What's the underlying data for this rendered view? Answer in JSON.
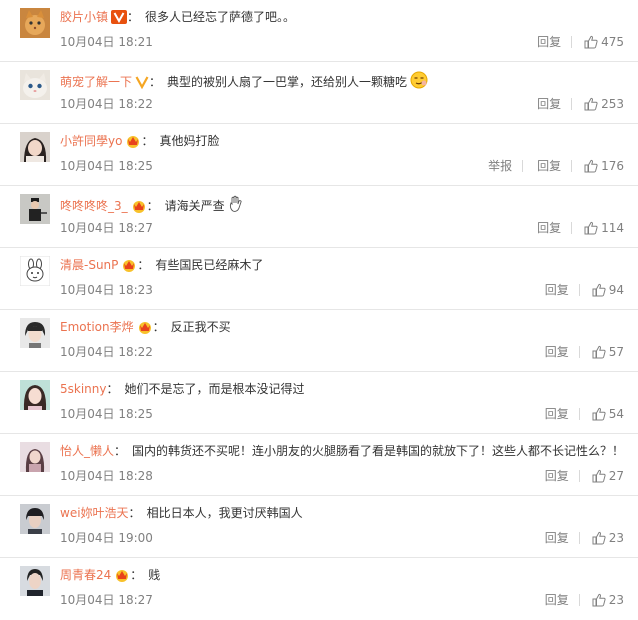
{
  "comments": [
    {
      "user": "胶片小镇",
      "badge": "v-gold",
      "text": "很多人已经忘了萨德了吧。。",
      "time": "10月04日 18:21",
      "actions": [
        "回复"
      ],
      "likes": "475",
      "emoji": null
    },
    {
      "user": "萌宠了解一下",
      "badge": "v-yellow",
      "text": "典型的被别人扇了一巴掌，还给别人一颗糖吃",
      "time": "10月04日 18:22",
      "actions": [
        "回复"
      ],
      "likes": "253",
      "emoji": "smirk-emoji"
    },
    {
      "user": "小許同學yo",
      "badge": "crown",
      "text": "真他妈打脸",
      "time": "10月04日 18:25",
      "actions": [
        "举报",
        "回复"
      ],
      "likes": "176",
      "emoji": null
    },
    {
      "user": "咚咚咚咚_3_",
      "badge": "crown",
      "text": "请海关严查",
      "time": "10月04日 18:27",
      "actions": [
        "回复"
      ],
      "likes": "114",
      "emoji": "hand-emoji"
    },
    {
      "user": "清晨-SunP",
      "badge": "crown",
      "text": "有些国民已经麻木了",
      "time": "10月04日 18:23",
      "actions": [
        "回复"
      ],
      "likes": "94",
      "emoji": null
    },
    {
      "user": "Emotion李烨",
      "badge": "crown",
      "text": "反正我不买",
      "time": "10月04日 18:22",
      "actions": [
        "回复"
      ],
      "likes": "57",
      "emoji": null
    },
    {
      "user": "5skinny",
      "badge": null,
      "text": "她们不是忘了，而是根本没记得过",
      "time": "10月04日 18:25",
      "actions": [
        "回复"
      ],
      "likes": "54",
      "emoji": null
    },
    {
      "user": "怡人_懒人",
      "badge": null,
      "text": "国内的韩货还不买呢！连小朋友的火腿肠看了看是韩国的就放下了！这些人都不长记性么？！",
      "time": "10月04日 18:28",
      "actions": [
        "回复"
      ],
      "likes": "27",
      "emoji": null
    },
    {
      "user": "wei妳叶浩天",
      "badge": null,
      "text": "相比日本人，我更讨厌韩国人",
      "time": "10月04日 19:00",
      "actions": [
        "回复"
      ],
      "likes": "23",
      "emoji": null
    },
    {
      "user": "周青春24",
      "badge": "crown",
      "text": "贱",
      "time": "10月04日 18:27",
      "actions": [
        "回复"
      ],
      "likes": "23",
      "emoji": null
    }
  ],
  "colors": {
    "username": "#eb7350",
    "meta": "#808080",
    "divider": "#e6e6e6"
  }
}
